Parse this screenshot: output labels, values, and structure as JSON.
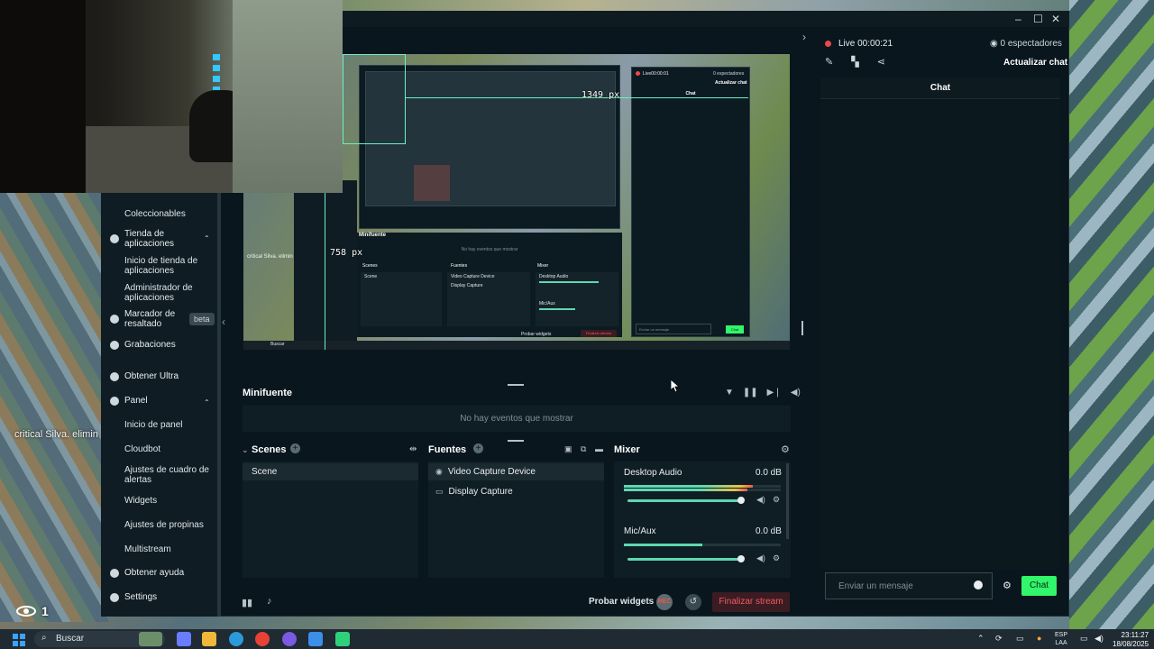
{
  "overlay": {
    "stream_text": "critical Silva. elimin",
    "viewer_count": "1"
  },
  "window": {
    "minimize": "–",
    "maximize": "☐",
    "close": "✕"
  },
  "sidebar": {
    "items": [
      {
        "label": "Coleccionables",
        "kind": "item"
      },
      {
        "label": "Tienda de aplicaciones",
        "kind": "head",
        "icon": "store-icon"
      },
      {
        "label": "Inicio de tienda de aplicaciones",
        "kind": "item"
      },
      {
        "label": "Administrador de aplicaciones",
        "kind": "item"
      },
      {
        "label": "Marcador de resaltado",
        "kind": "head",
        "icon": "highlight-icon"
      },
      {
        "label": "Grabaciones",
        "kind": "head",
        "icon": "record-icon"
      },
      {
        "label": "Obtener Ultra",
        "kind": "head",
        "icon": "ultra-icon"
      },
      {
        "label": "Panel",
        "kind": "head",
        "icon": "dashboard-icon"
      },
      {
        "label": "Inicio de panel",
        "kind": "item"
      },
      {
        "label": "Cloudbot",
        "kind": "item"
      },
      {
        "label": "Ajustes de cuadro de alertas",
        "kind": "item"
      },
      {
        "label": "Widgets",
        "kind": "item"
      },
      {
        "label": "Ajustes de propinas",
        "kind": "item"
      },
      {
        "label": "Multistream",
        "kind": "item"
      },
      {
        "label": "Obtener ayuda",
        "kind": "head",
        "icon": "help-icon"
      },
      {
        "label": "Settings",
        "kind": "head",
        "icon": "gear-icon"
      }
    ],
    "beta_badge": "beta"
  },
  "preview": {
    "width_label": "1349 px",
    "height_label": "758 px",
    "nested_overlay_text": "critical Silva. elimin",
    "nested_minifuente": "Minifuente",
    "nested_no_events": "No hay eventos que mostrar",
    "nested_scenes": "Scenes",
    "nested_sources": "Fuentes",
    "nested_mixer": "Mixer",
    "nested_scene": "Scene",
    "nested_source1": "Video Capture Device",
    "nested_source2": "Display Capture",
    "nested_desktop": "Desktop Audio",
    "nested_mic": "Mic/Aux",
    "nested_live": "Live00:00:01",
    "nested_viewers": "0 espectadores",
    "nested_refresh": "Actualizar chat",
    "nested_chat": "Chat",
    "nested_input": "Enviar un mensaje",
    "nested_chat_btn": "Chat",
    "nested_probar": "Probar widgets",
    "nested_finish": "Finalizar stream",
    "nested_search": "Buscar"
  },
  "minifuente": {
    "title": "Minifuente",
    "empty": "No hay eventos que mostrar"
  },
  "scenes": {
    "title": "Scenes",
    "items": [
      "Scene"
    ]
  },
  "sources": {
    "title": "Fuentes",
    "items": [
      "Video Capture Device",
      "Display Capture"
    ]
  },
  "mixer": {
    "title": "Mixer",
    "channels": [
      {
        "name": "Desktop Audio",
        "db": "0.0 dB",
        "level": 0.82,
        "volume": 1.0
      },
      {
        "name": "Mic/Aux",
        "db": "0.0 dB",
        "level": 0.5,
        "volume": 1.0
      }
    ]
  },
  "bottom": {
    "probar": "Probar widgets",
    "rec": "REC",
    "finish": "Finalizar stream"
  },
  "chat": {
    "live": "Live 00:00:21",
    "viewers": "0 espectadores",
    "refresh": "Actualizar chat",
    "header": "Chat",
    "input_placeholder": "Enviar un mensaje",
    "send": "Chat"
  },
  "taskbar": {
    "search": "Buscar",
    "lang": "ESP",
    "lang2": "LAA",
    "time": "23:11:27",
    "date": "18/08/2025"
  }
}
